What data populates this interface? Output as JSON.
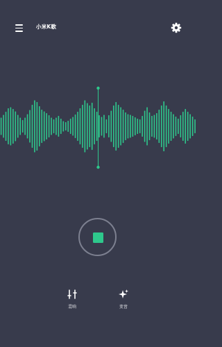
{
  "header": {
    "menu_icon": "hamburger-menu-icon",
    "title": "小米K歌",
    "settings_icon": "gear-icon"
  },
  "waveform": {
    "bar_color": "#2ec88c",
    "cursor_color": "#2ec88c",
    "levels": [
      0.25,
      0.33,
      0.42,
      0.52,
      0.55,
      0.5,
      0.43,
      0.33,
      0.25,
      0.18,
      0.25,
      0.35,
      0.47,
      0.62,
      0.75,
      0.7,
      0.58,
      0.48,
      0.43,
      0.38,
      0.32,
      0.25,
      0.2,
      0.25,
      0.3,
      0.22,
      0.15,
      0.12,
      0.16,
      0.22,
      0.27,
      0.34,
      0.42,
      0.52,
      0.62,
      0.75,
      0.67,
      0.6,
      0.68,
      0.52,
      0.42,
      0.32,
      0.27,
      0.33,
      0.2,
      0.32,
      0.45,
      0.6,
      0.7,
      0.62,
      0.55,
      0.48,
      0.4,
      0.35,
      0.33,
      0.3,
      0.26,
      0.22,
      0.2,
      0.3,
      0.45,
      0.55,
      0.4,
      0.3,
      0.33,
      0.38,
      0.48,
      0.6,
      0.72,
      0.6,
      0.5,
      0.42,
      0.35,
      0.28,
      0.22,
      0.32,
      0.42,
      0.5,
      0.42,
      0.35,
      0.28,
      0.2
    ]
  },
  "record": {
    "accent": "#2ec88c",
    "ring_color": "#7d8090",
    "state": "recording"
  },
  "tools": [
    {
      "icon": "equalizer-sliders-icon",
      "label": "混响"
    },
    {
      "icon": "sparkle-icon",
      "label": "变音"
    }
  ]
}
